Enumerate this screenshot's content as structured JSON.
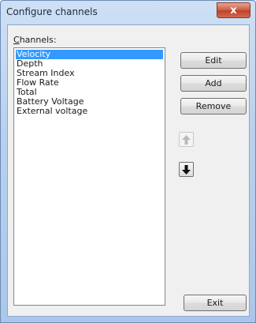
{
  "window": {
    "title": "Configure channels",
    "close_glyph": "x"
  },
  "channels": {
    "label_access_key": "C",
    "label_rest": "hannels:",
    "items": [
      "Velocity",
      "Depth",
      "Stream Index",
      "Flow Rate",
      "Total",
      "Battery Voltage",
      "External voltage"
    ],
    "selected_index": 0
  },
  "buttons": {
    "edit": "Edit",
    "add": "Add",
    "remove": "Remove",
    "exit": "Exit"
  },
  "icons": {
    "move_up": "arrow-up-icon",
    "move_down": "arrow-down-icon"
  },
  "colors": {
    "selection": "#3399ff",
    "title_gradient_top": "#cfe0f4",
    "close_button": "#c0422b"
  }
}
